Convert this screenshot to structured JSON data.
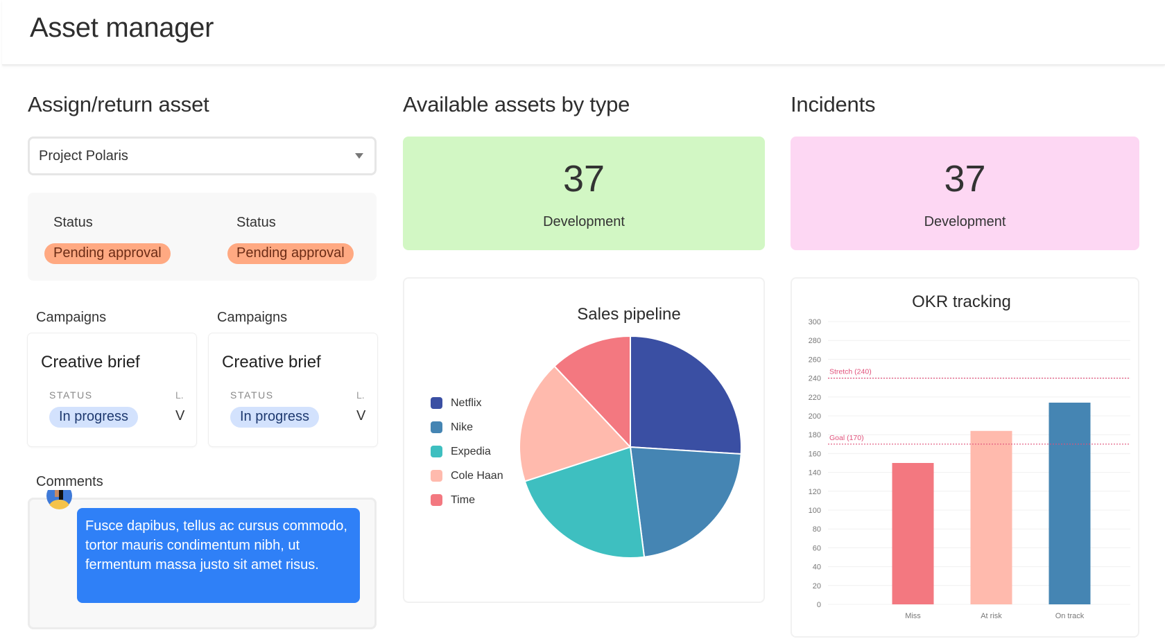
{
  "header": {
    "title": "Asset manager"
  },
  "assign": {
    "title": "Assign/return asset",
    "select": {
      "value": "Project Polaris",
      "icon": "caret-down-icon"
    },
    "statuses": [
      {
        "label": "Status",
        "badge": "Pending approval"
      },
      {
        "label": "Status",
        "badge": "Pending approval"
      }
    ],
    "campaigns": [
      {
        "section_label": "Campaigns",
        "title": "Creative brief",
        "status_label": "STATUS",
        "status": "In progress",
        "extra_label": "L.",
        "extra_value": "V"
      },
      {
        "section_label": "Campaigns",
        "title": "Creative brief",
        "status_label": "STATUS",
        "status": "In progress",
        "extra_label": "L.",
        "extra_value": "V"
      }
    ],
    "comments": {
      "label": "Comments",
      "items": [
        {
          "text": "Fusce dapibus, tellus ac cursus commodo, tortor mauris condimentum nibh, ut fermentum massa justo sit amet risus."
        }
      ]
    }
  },
  "available": {
    "title": "Available assets by type",
    "kpi": {
      "value": "37",
      "label": "Development",
      "color": "#d2f7c4"
    }
  },
  "incidents": {
    "title": "Incidents",
    "kpi": {
      "value": "37",
      "label": "Development",
      "color": "#fdd7f3"
    }
  },
  "chart_data": [
    {
      "type": "pie",
      "title": "Sales pipeline",
      "legend_position": "left",
      "categories": [
        "Netflix",
        "Nike",
        "Expedia",
        "Cole Haan",
        "Time"
      ],
      "values": [
        26,
        22,
        22,
        18,
        12
      ],
      "colors": [
        "#3a4fa3",
        "#4585b3",
        "#3ebfc0",
        "#ffbaad",
        "#f37880"
      ]
    },
    {
      "type": "bar",
      "title": "OKR tracking",
      "categories": [
        "Miss",
        "At risk",
        "On track"
      ],
      "values": [
        150,
        184,
        214
      ],
      "colors": [
        "#f37880",
        "#ffbaad",
        "#4585b3"
      ],
      "ylim": [
        0,
        300
      ],
      "yticks": [
        0,
        20,
        40,
        60,
        80,
        100,
        120,
        140,
        160,
        180,
        200,
        220,
        240,
        260,
        280,
        300
      ],
      "grid": true,
      "reference_lines": [
        {
          "label": "Stretch (240)",
          "value": 240,
          "color": "#e0507a"
        },
        {
          "label": "Goal (170)",
          "value": 170,
          "color": "#e0507a"
        }
      ],
      "xlabel": "",
      "ylabel": ""
    }
  ]
}
